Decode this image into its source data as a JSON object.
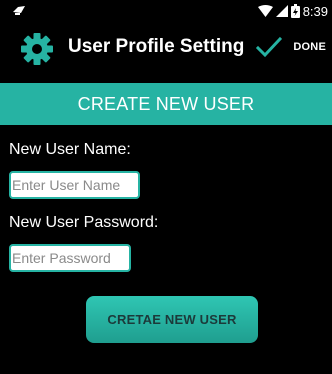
{
  "status_bar": {
    "time": "8:39",
    "left_icon": "notification-icon",
    "icons": [
      "wifi-icon",
      "signal-icon",
      "battery-icon"
    ]
  },
  "action_bar": {
    "title": "User Profile Setting",
    "app_icon": "gear-icon",
    "check_icon": "check-icon",
    "done_label": "DONE"
  },
  "banner": {
    "title": "CREATE NEW USER"
  },
  "form": {
    "username_label": "New User Name:",
    "username_placeholder": "Enter User Name",
    "password_label": "New User Password:",
    "password_placeholder": "Enter Password",
    "submit_label": "CRETAE NEW USER"
  },
  "colors": {
    "accent": "#26B3A3",
    "background": "#000000",
    "text": "#FFFFFF"
  }
}
